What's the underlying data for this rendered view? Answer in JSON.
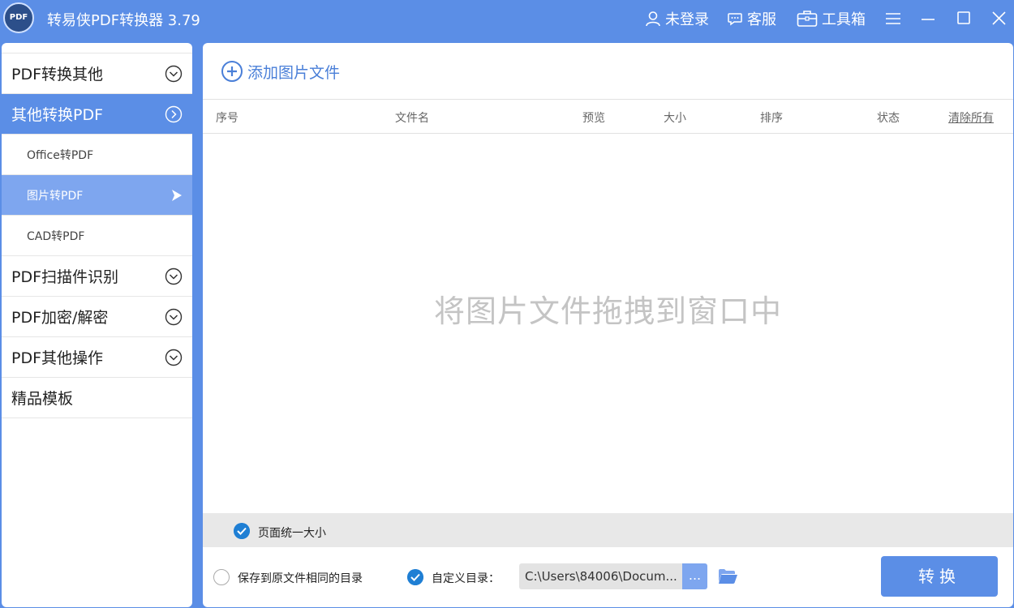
{
  "app": {
    "title": "转易侠PDF转换器 3.79",
    "logo_text": "PDF"
  },
  "titlebar": {
    "login_label": "未登录",
    "service_label": "客服",
    "toolbox_label": "工具箱"
  },
  "sidebar": {
    "items": [
      {
        "label": "PDF转换其他"
      },
      {
        "label": "其他转换PDF"
      },
      {
        "label": "Office转PDF"
      },
      {
        "label": "图片转PDF"
      },
      {
        "label": "CAD转PDF"
      },
      {
        "label": "PDF扫描件识别"
      },
      {
        "label": "PDF加密/解密"
      },
      {
        "label": "PDF其他操作"
      },
      {
        "label": "精品模板"
      }
    ]
  },
  "main": {
    "add_label": "添加图片文件",
    "columns": {
      "index": "序号",
      "filename": "文件名",
      "preview": "预览",
      "size": "大小",
      "order": "排序",
      "status": "状态",
      "clear_all": "清除所有"
    },
    "drop_hint": "将图片文件拖拽到窗口中",
    "uniform_size_label": "页面统一大小",
    "same_dir_label": "保存到原文件相同的目录",
    "custom_dir_label": "自定义目录：",
    "path_value": "C:\\Users\\84006\\Docum...",
    "browse_label": "...",
    "convert_label": "转换"
  },
  "colors": {
    "primary": "#5b8ee6",
    "sub_active": "#7ea6ef",
    "check": "#1f7fd4"
  }
}
